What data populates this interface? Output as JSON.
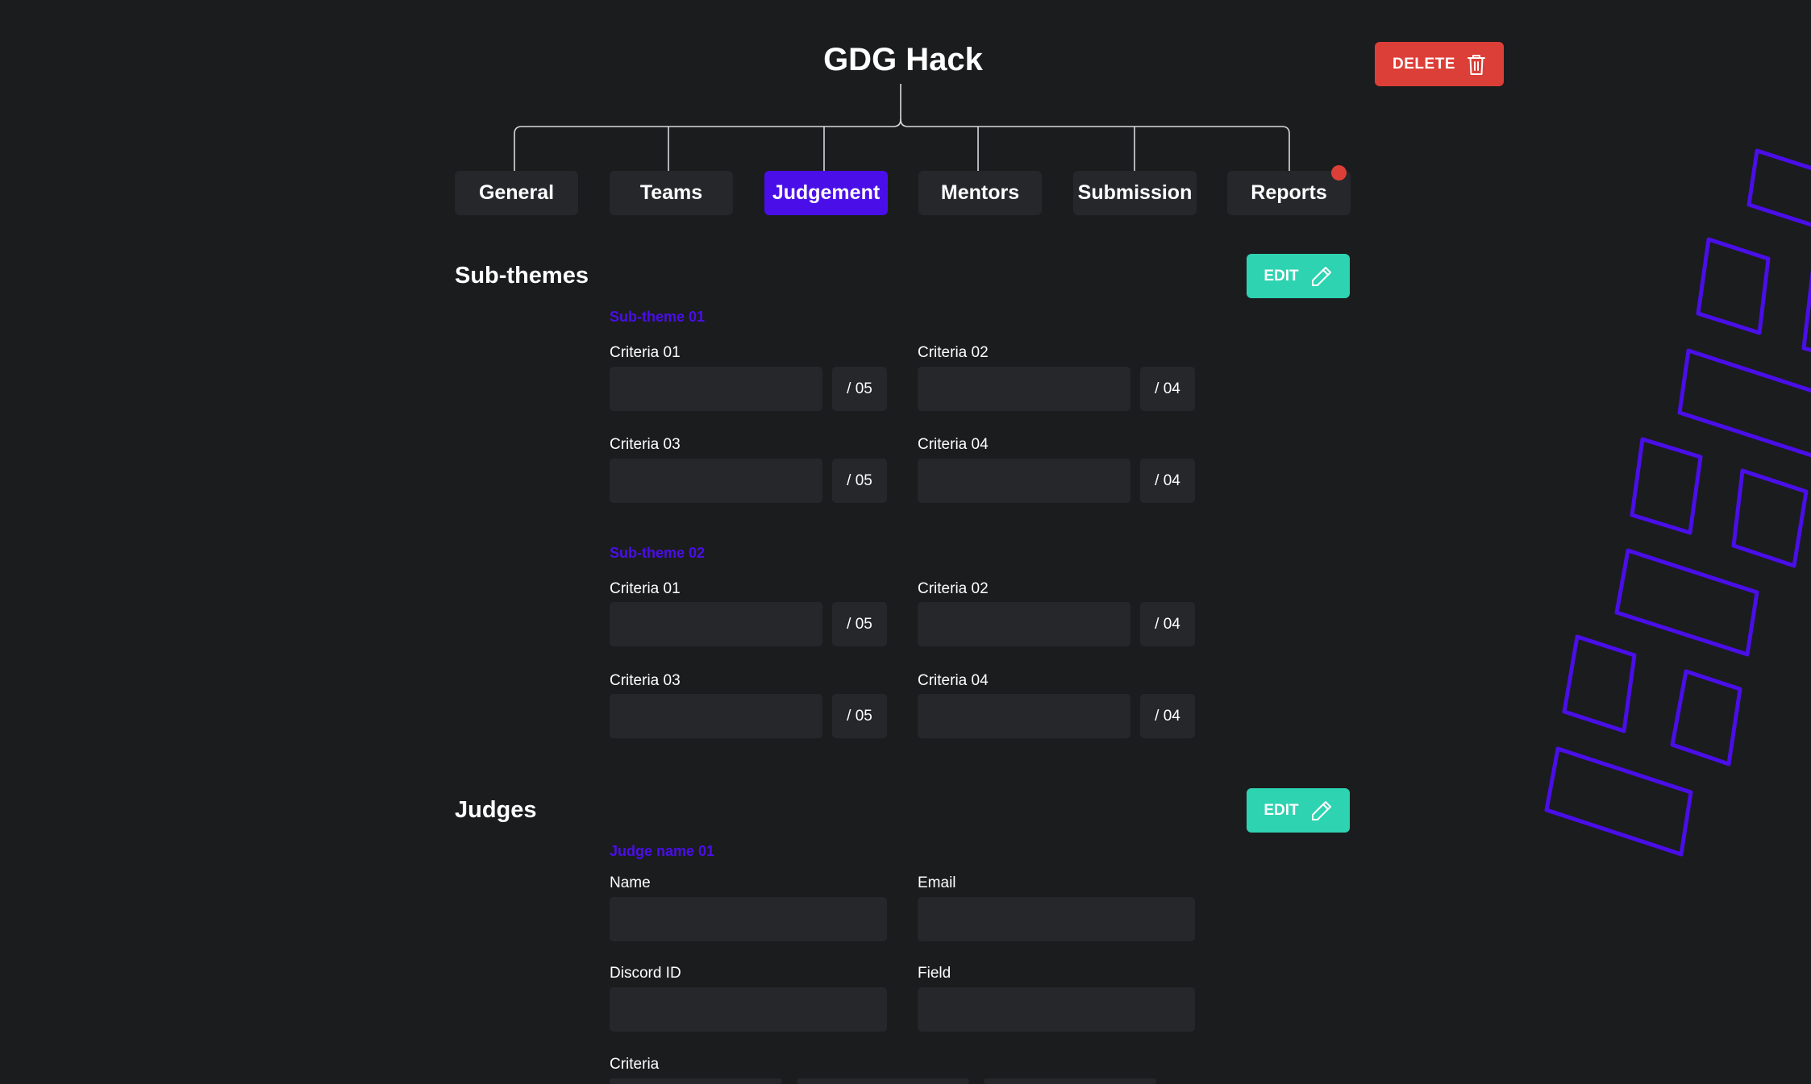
{
  "event": {
    "title": "GDG Hack"
  },
  "actions": {
    "delete_label": "DELETE",
    "edit_label": "EDIT"
  },
  "tabs": [
    {
      "label": "General"
    },
    {
      "label": "Teams"
    },
    {
      "label": "Judgement",
      "active": true
    },
    {
      "label": "Mentors"
    },
    {
      "label": "Submission"
    },
    {
      "label": "Reports",
      "has_notification": true
    }
  ],
  "subthemes": {
    "title": "Sub-themes",
    "groups": [
      {
        "name": "Sub-theme 01",
        "criteria": [
          {
            "label": "Criteria 01",
            "value": "",
            "max": "/ 05"
          },
          {
            "label": "Criteria 02",
            "value": "",
            "max": "/ 04"
          },
          {
            "label": "Criteria 03",
            "value": "",
            "max": "/ 05"
          },
          {
            "label": "Criteria 04",
            "value": "",
            "max": "/ 04"
          }
        ]
      },
      {
        "name": "Sub-theme 02",
        "criteria": [
          {
            "label": "Criteria 01",
            "value": "",
            "max": "/ 05"
          },
          {
            "label": "Criteria 02",
            "value": "",
            "max": "/ 04"
          },
          {
            "label": "Criteria 03",
            "value": "",
            "max": "/ 05"
          },
          {
            "label": "Criteria 04",
            "value": "",
            "max": "/ 04"
          }
        ]
      }
    ]
  },
  "judges": {
    "title": "Judges",
    "judge": {
      "name": "Judge name 01",
      "fields": {
        "name_label": "Name",
        "name_value": "",
        "email_label": "Email",
        "email_value": "",
        "discord_label": "Discord ID",
        "discord_value": "",
        "field_label": "Field",
        "field_value": "",
        "criteria_label": "Criteria"
      }
    }
  },
  "colors": {
    "background": "#1b1c1e",
    "surface": "#26272b",
    "accent": "#4a0ee8",
    "danger": "#dc3f38",
    "edit": "#2ed3b1"
  }
}
